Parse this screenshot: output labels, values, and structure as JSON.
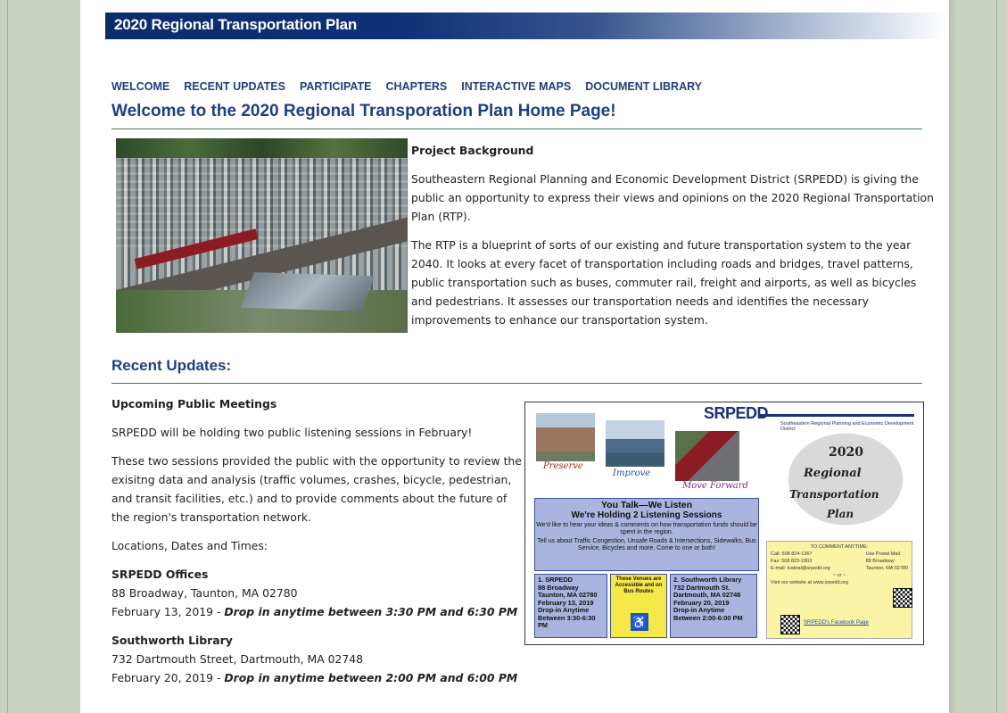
{
  "banner": {
    "title": "2020 Regional Transportation Plan"
  },
  "nav": [
    "WELCOME",
    "RECENT UPDATES",
    "PARTICIPATE",
    "CHAPTERS",
    "INTERACTIVE MAPS",
    "DOCUMENT LIBRARY"
  ],
  "page_heading": "Welcome to the 2020 Regional Transporation Plan Home Page!",
  "background": {
    "subhead": "Project Background",
    "p1": "Southeastern Regional Planning and Economic Development District (SRPEDD) is giving the public an opportunity to express their views and opinions on the 2020 Regional Transportation Plan (RTP).",
    "p2": "The RTP is a blueprint of sorts of our existing and future transportation system to the year 2040. It looks at every facet of transportation including roads and bridges, travel patterns, public transportation such as buses, commuter rail, freight and airports, as well as bicycles and pedestrians. It assesses our transportation needs and identifies the necessary improvements to enhance our transportation system."
  },
  "updates": {
    "heading": "Recent Updates:",
    "subhead": "Upcoming Public Meetings",
    "p1": "SRPEDD will be holding two public listening sessions in February!",
    "p2": "These two sessions provided the public with the opportunity to review the exisitng data and analysis (traffic volumes, crashes, bicycle, pedestrian, and transit facilities, etc.) and to provide comments about the future of the region's transportation network.",
    "p3": "Locations, Dates and Times:",
    "loc1_name": "SRPEDD Offices",
    "loc1_address": "88 Broadway, Taunton, MA 02780",
    "loc1_date": "February 13, 2019 - ",
    "loc1_time": "Drop in anytime between 3:30 PM and 6:30 PM",
    "loc2_name": "Southworth Library",
    "loc2_address": "732 Dartmouth Street, Dartmouth, MA 02748",
    "loc2_date": "February 20, 2019 - ",
    "loc2_time": "Drop in anytime between 2:00 PM and 6:00 PM"
  },
  "flyer": {
    "logo": "SRPEDD",
    "tagline": "Southeastern Regional Planning and Economic Development District",
    "word1": "Preserve",
    "word2": "Improve",
    "word3": "Move Forward",
    "year": "2020",
    "title1": "Regional",
    "title2": "Transportation",
    "title3": "Plan",
    "listen_h1": "You Talk—We Listen",
    "listen_h2": "We're Holding 2 Listening Sessions",
    "listen_t1": "We'd like to hear your ideas & comments on how transportation funds should be spent in the region.",
    "listen_t2": "Tell us about Traffic Congestion, Unsafe Roads & Intersections, Sidewalks, Bus Service, Bicycles and more. Come to one or both!",
    "box1": "1. SRPEDD\n88 Broadway\nTaunton, MA 02780\nFebruary 13, 2019\nDrop-in Anytime\nBetween 3:30-6:30 PM",
    "box2": "These Venues are Accessible and on Bus Routes",
    "box3": "2. Southworth Library\n732 Dartmouth St.\nDartmouth, MA 02748\nFebruary 20, 2019\nDrop-in Anytime\nBetween 2:00-6:00 PM",
    "comment_title": "TO COMMENT ANYTIME:",
    "comment_call": "Call: 508 824-1367",
    "comment_fax": "Fax: 508 823-1803",
    "comment_email": "E-mail: lcabral@srpedd.org",
    "comment_mail1": "Use Postal Mail:",
    "comment_mail2": "88 Broadway",
    "comment_mail3": "Taunton, MA 02780",
    "comment_or": "~ or ~",
    "comment_web": "Visit our website at www.srpedd.org",
    "comment_fb": "SRPEDD's Facebook Page"
  }
}
